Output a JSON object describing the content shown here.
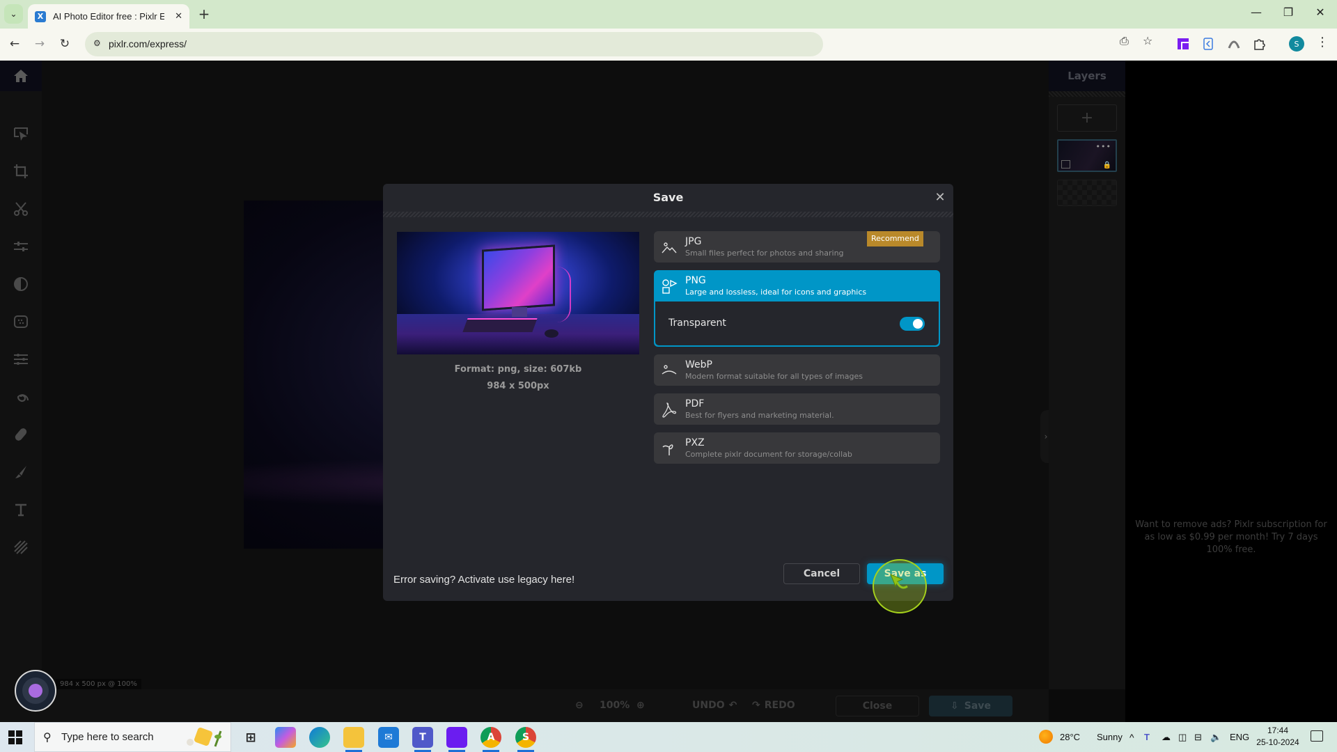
{
  "browser": {
    "tab_title": "AI Photo Editor free : Pixlr Expre",
    "tab_favicon_letter": "X",
    "url": "pixlr.com/express/",
    "profile_initial": "S",
    "window_controls": {
      "minimize": "—",
      "restore": "❐",
      "close": "✕"
    }
  },
  "app": {
    "layers_title": "Layers",
    "layer_add_label": "+",
    "layer_more": "•••",
    "dimension_readout": "984 x 500 px @ 100%",
    "ad_text": "Want to remove ads? Pixlr subscription for as low as $0.99 per month! Try 7 days 100% free.",
    "rail_tools": [
      "home",
      "arrange",
      "crop",
      "cutout",
      "adjust",
      "filter",
      "effect",
      "liquify",
      "swirl",
      "retouch",
      "draw",
      "text",
      "pattern"
    ],
    "bottom_bar": {
      "zoom_value": "100%",
      "undo_label": "UNDO",
      "redo_label": "REDO",
      "close_label": "Close",
      "save_label": "Save"
    }
  },
  "save_dialog": {
    "title": "Save",
    "close_icon": "✕",
    "preview": {
      "format_info": "Format: png, size: 607kb",
      "dimensions": "984 x 500px"
    },
    "formats": [
      {
        "name": "JPG",
        "description": "Small files perfect for photos and sharing",
        "badge": "Recommend",
        "icon": "mountain-icon",
        "selected": false
      },
      {
        "name": "PNG",
        "description": "Large and lossless, ideal for icons and graphics",
        "icon": "shapes-icon",
        "selected": true
      },
      {
        "name": "WebP",
        "description": "Modern format suitable for all types of images",
        "icon": "webp-icon",
        "selected": false
      },
      {
        "name": "PDF",
        "description": "Best for flyers and marketing material.",
        "icon": "pdf-icon",
        "selected": false
      },
      {
        "name": "PXZ",
        "description": "Complete pixlr document for storage/collab",
        "icon": "pxz-icon",
        "selected": false
      }
    ],
    "transparent": {
      "label": "Transparent",
      "enabled": true
    },
    "legacy_link": "Error saving? Activate use legacy here!",
    "cancel_label": "Cancel",
    "save_as_label": "Save as",
    "accent_color": "#0096c7",
    "badge_color": "#b9892a"
  },
  "taskbar": {
    "search_placeholder": "Type here to search",
    "weather_temp": "28°C",
    "weather_desc": "Sunny",
    "language": "ENG",
    "time": "17:44",
    "date": "25-10-2024",
    "apps": [
      "task-view",
      "copilot",
      "edge",
      "file-explorer",
      "mail",
      "teams",
      "pixlr",
      "chrome-a",
      "chrome-s"
    ]
  }
}
